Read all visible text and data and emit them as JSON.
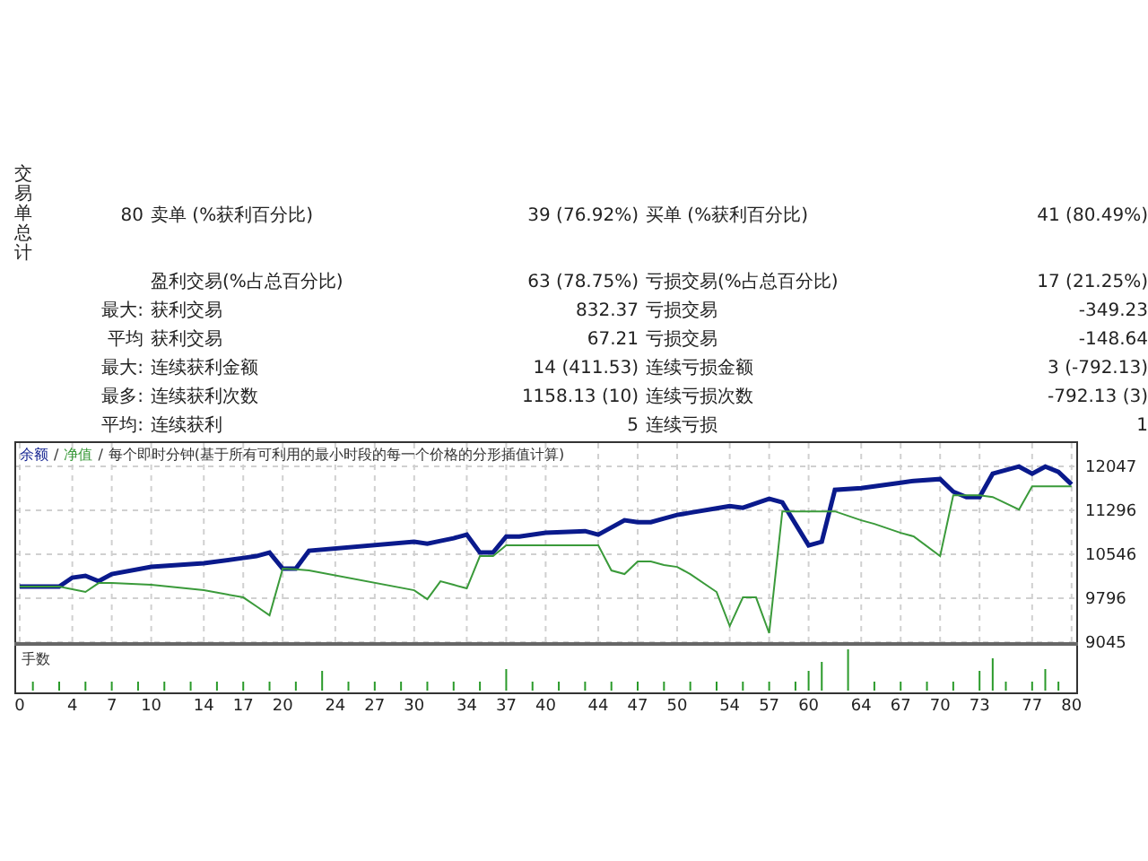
{
  "summary": {
    "vertical_label": "交易单总计",
    "groups": [
      [
        {
          "prefix": "80",
          "label_1": "卖单 (%获利百分比)",
          "value_1": "39 (76.92%)",
          "label_2": "买单 (%获利百分比)",
          "value_2": "41 (80.49%)"
        }
      ],
      [
        {
          "label_1": "盈利交易(%占总百分比)",
          "value_1": "63 (78.75%)",
          "label_2": "亏损交易(%占总百分比)",
          "value_2": "17 (21.25%)"
        },
        {
          "prefix": "最大:",
          "label_1": "获利交易",
          "value_1": "832.37",
          "label_2": "亏损交易",
          "value_2": "-349.23"
        },
        {
          "prefix": "平均",
          "label_1": "获利交易",
          "value_1": "67.21",
          "label_2": "亏损交易",
          "value_2": "-148.64"
        },
        {
          "prefix": "最大:",
          "label_1": "连续获利金额",
          "value_1": "14 (411.53)",
          "label_2": "连续亏损金额",
          "value_2": "3 (-792.13)"
        },
        {
          "prefix": "最多:",
          "label_1": "连续获利次数",
          "value_1": "1158.13 (10)",
          "label_2": "连续亏损次数",
          "value_2": "-792.13 (3)"
        },
        {
          "prefix": "平均:",
          "label_1": "连续获利",
          "value_1": "5",
          "label_2": "连续亏损",
          "value_2": "1"
        }
      ]
    ]
  },
  "chart": {
    "legend_separator": "/",
    "volume_label": "手数",
    "chart_data": {
      "type": "line",
      "title": "每个即时分钟(基于所有可利用的最小时段的每一个价格的分形插值计算)",
      "x": [
        0,
        3,
        4,
        5,
        6,
        7,
        10,
        14,
        17,
        18,
        19,
        20,
        21,
        22,
        30,
        31,
        32,
        33,
        34,
        35,
        36,
        37,
        38,
        40,
        43,
        44,
        45,
        46,
        47,
        48,
        49,
        50,
        51,
        53,
        54,
        55,
        56,
        57,
        58,
        60,
        61,
        62,
        64,
        65,
        67,
        68,
        70,
        71,
        72,
        73,
        74,
        76,
        77,
        78,
        79,
        80
      ],
      "series": [
        {
          "name": "余额",
          "color": "#0a1a8c",
          "values": [
            9994,
            9994,
            10147,
            10178,
            10086,
            10208,
            10330,
            10392,
            10483,
            10514,
            10575,
            10300,
            10300,
            10606,
            10759,
            10728,
            10774,
            10820,
            10881,
            10575,
            10575,
            10850,
            10850,
            10912,
            10942,
            10881,
            11003,
            11126,
            11095,
            11095,
            11156,
            11218,
            11256,
            11330,
            11370,
            11340,
            11416,
            11493,
            11432,
            10698,
            10759,
            11646,
            11677,
            11707,
            11768,
            11799,
            11830,
            11615,
            11523,
            11523,
            11922,
            12044,
            11922,
            12044,
            11952,
            11738
          ]
        },
        {
          "name": "净值",
          "color": "#3a9a3a",
          "values": [
            9994,
            9994,
            9948,
            9902,
            10055,
            10055,
            10024,
            9932,
            9810,
            9657,
            9504,
            10300,
            10290,
            10270,
            9932,
            9779,
            10085,
            10024,
            9963,
            10514,
            10514,
            10698,
            10698,
            10698,
            10698,
            10698,
            10269,
            10208,
            10422,
            10422,
            10361,
            10330,
            10208,
            9902,
            9320,
            9810,
            9810,
            9198,
            11279,
            11279,
            11279,
            11279,
            11126,
            11065,
            10912,
            10850,
            10514,
            11554,
            11554,
            11554,
            11523,
            11309,
            11707,
            11707,
            11707,
            11707
          ]
        }
      ],
      "grid": true,
      "xlim": [
        0,
        80
      ],
      "ylim": [
        9045,
        12047
      ],
      "xticks": [
        0,
        4,
        7,
        10,
        14,
        17,
        20,
        24,
        27,
        30,
        34,
        37,
        40,
        44,
        47,
        50,
        54,
        57,
        60,
        64,
        67,
        70,
        73,
        77,
        80
      ],
      "yticks": [
        9045,
        9796,
        10546,
        11296,
        12047
      ]
    }
  }
}
